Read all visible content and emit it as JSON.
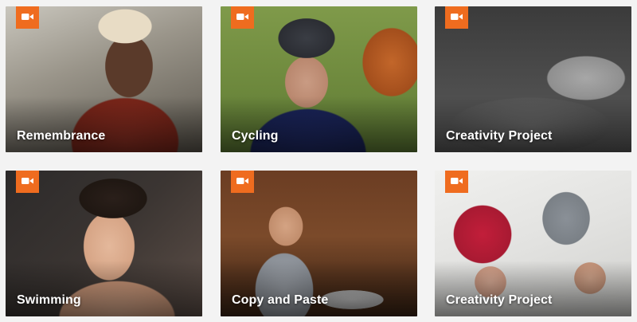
{
  "accent_color": "#ef6c1f",
  "badge_icon": "video-camera-icon",
  "cards": [
    {
      "title": "Remembrance"
    },
    {
      "title": "Cycling"
    },
    {
      "title": "Creativity Project"
    },
    {
      "title": "Swimming"
    },
    {
      "title": "Copy and Paste"
    },
    {
      "title": "Creativity Project"
    }
  ]
}
